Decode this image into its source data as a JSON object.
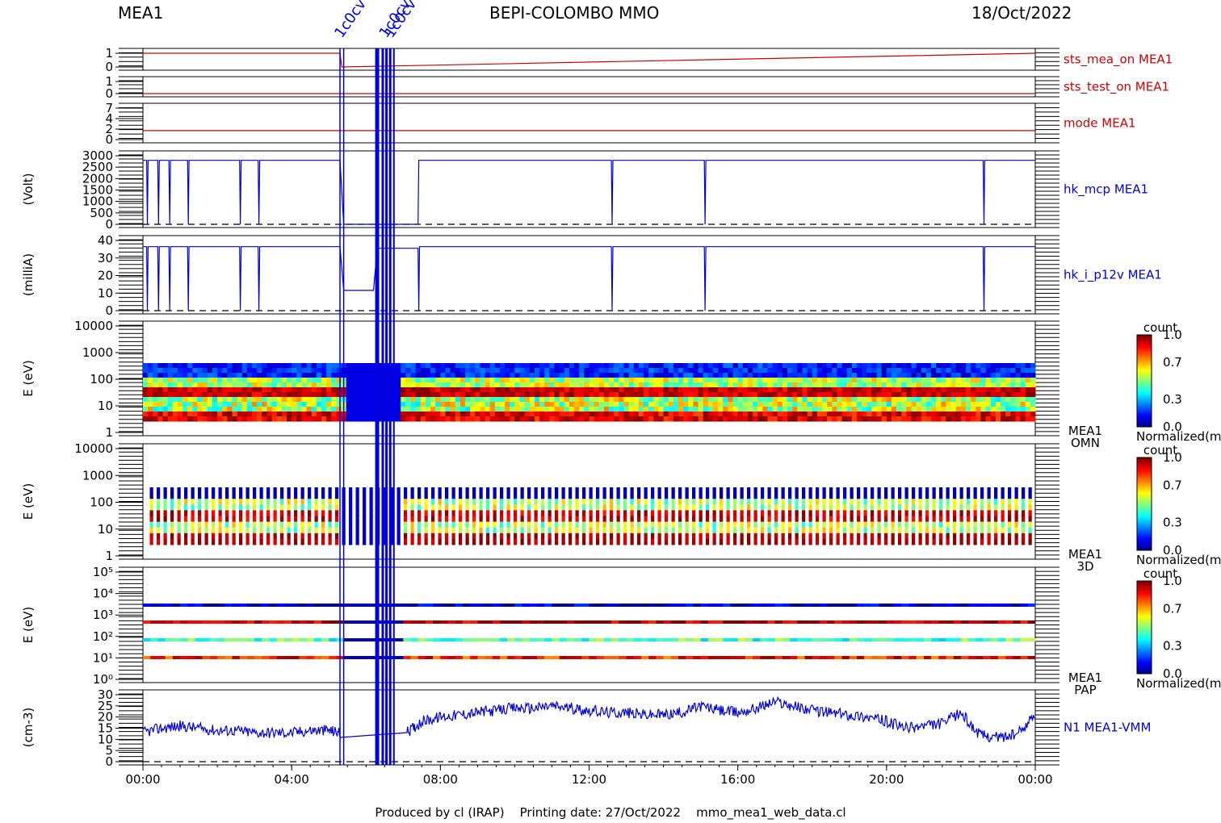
{
  "header": {
    "left": "MEA1",
    "center": "BEPI-COLOMBO MMO",
    "right": "18/Oct/2022"
  },
  "footer": "Produced by cl (IRAP)    Printing date: 27/Oct/2022    mmo_mea1_web_data.cl",
  "colors": {
    "status": "#d00000",
    "data": "#0000dd",
    "axis": "#000000"
  },
  "event_labels": [
    "1c0cv",
    "1c0cv",
    "1c0cv"
  ],
  "chart_data": [
    {
      "type": "line",
      "name": "sts_mea_on MEA1",
      "yticks": [
        "1",
        "0"
      ],
      "ylim": [
        0,
        1
      ],
      "x": [
        0,
        5.3,
        5.35,
        24
      ],
      "values": [
        1,
        1,
        0,
        1
      ]
    },
    {
      "type": "line",
      "name": "sts_test_on MEA1",
      "yticks": [
        "1",
        "0"
      ],
      "ylim": [
        0,
        1
      ],
      "x": [
        0,
        24
      ],
      "values": [
        0,
        0
      ]
    },
    {
      "type": "line",
      "name": "mode MEA1",
      "yticks": [
        "7",
        "4",
        "2",
        "0"
      ],
      "ylim": [
        0,
        7
      ],
      "x": [
        0,
        24
      ],
      "values": [
        2,
        2
      ]
    },
    {
      "type": "line",
      "name": "hk_mcp MEA1",
      "ylabel": "(Volt)",
      "yticks": [
        "3000",
        "2500",
        "2000",
        "1500",
        "1000",
        "500",
        "0"
      ],
      "ylim": [
        0,
        3000
      ],
      "x": [
        0,
        0.1,
        0.12,
        0.14,
        0.4,
        0.42,
        0.44,
        0.7,
        0.72,
        0.74,
        1.2,
        1.22,
        1.24,
        2.6,
        2.62,
        2.64,
        3.1,
        3.12,
        3.14,
        5.3,
        5.4,
        7.4,
        7.42,
        7.44,
        12.6,
        12.62,
        12.64,
        15.1,
        15.12,
        15.14,
        22.6,
        22.62,
        22.64,
        24
      ],
      "values": [
        2800,
        2800,
        0,
        2800,
        2800,
        0,
        2800,
        2800,
        0,
        2800,
        2800,
        0,
        2800,
        2800,
        0,
        2800,
        2800,
        0,
        2800,
        2800,
        0,
        0,
        2800,
        2800,
        2800,
        0,
        2800,
        2800,
        0,
        2800,
        2800,
        0,
        2800,
        2800
      ]
    },
    {
      "type": "line",
      "name": "hk_i_p12v MEA1",
      "ylabel": "(milliA)",
      "yticks": [
        "40",
        "30",
        "20",
        "10",
        "0"
      ],
      "ylim": [
        0,
        45
      ],
      "x": [
        0,
        0.1,
        0.12,
        0.14,
        0.4,
        0.42,
        0.44,
        0.7,
        0.72,
        0.74,
        1.2,
        1.22,
        1.24,
        2.6,
        2.62,
        2.64,
        3.1,
        3.12,
        3.14,
        5.3,
        5.4,
        6.2,
        6.3,
        7.4,
        7.42,
        7.44,
        12.6,
        12.62,
        12.64,
        15.1,
        15.12,
        15.14,
        22.6,
        22.62,
        22.64,
        24
      ],
      "values": [
        41,
        41,
        0,
        41,
        41,
        0,
        41,
        41,
        0,
        41,
        41,
        0,
        41,
        41,
        0,
        41,
        41,
        0,
        41,
        41,
        13,
        13,
        40,
        40,
        0,
        41,
        41,
        0,
        41,
        41,
        0,
        41,
        41,
        0,
        41,
        41
      ]
    },
    {
      "type": "heatmap",
      "name": "MEA1 OMN",
      "ylabel": "E (eV)",
      "yticks": [
        "10000",
        "1000",
        "100",
        "10",
        "1"
      ],
      "colorbar": {
        "label": "count",
        "ticks": [
          "1.0",
          "0.7",
          "0.3",
          "0.0"
        ],
        "unit": "Normalized(m"
      }
    },
    {
      "type": "heatmap",
      "name": "MEA1 3D",
      "ylabel": "E (eV)",
      "yticks": [
        "10000",
        "1000",
        "100",
        "10",
        "1"
      ],
      "colorbar": {
        "label": "count",
        "ticks": [
          "1.0",
          "0.7",
          "0.3",
          "0.0"
        ],
        "unit": "Normalized(m"
      }
    },
    {
      "type": "heatmap",
      "name": "MEA1 PAP",
      "ylabel": "E (eV)",
      "yticks": [
        "10⁵",
        "10⁴",
        "10³",
        "10²",
        "10¹",
        "10⁰"
      ],
      "colorbar": {
        "label": "count",
        "ticks": [
          "1.0",
          "0.7",
          "0.3",
          "0.0"
        ],
        "unit": "Normalized(m"
      }
    },
    {
      "type": "line",
      "name": "N1 MEA1-VMM",
      "ylabel": "(cm-3)",
      "yticks": [
        "30",
        "25",
        "20",
        "15",
        "10",
        "5",
        "0"
      ],
      "ylim": [
        0,
        30
      ],
      "x": [
        0,
        0.5,
        1,
        1.5,
        2,
        2.5,
        3,
        3.5,
        4,
        4.5,
        5,
        5.3,
        7.1,
        7.5,
        8,
        8.5,
        9,
        9.5,
        10,
        10.5,
        11,
        11.5,
        12,
        12.5,
        13,
        13.5,
        14,
        14.5,
        15,
        15.5,
        16,
        16.5,
        17,
        17.5,
        18,
        18.5,
        19,
        19.5,
        20,
        20.5,
        21,
        21.5,
        22,
        22.5,
        23,
        23.5,
        24
      ],
      "values": [
        13,
        15,
        16,
        15,
        14,
        14,
        13,
        13,
        13,
        14,
        14,
        13,
        13,
        18,
        20,
        21,
        22,
        23,
        24,
        24,
        25,
        24,
        23,
        22,
        22,
        21,
        21,
        22,
        25,
        23,
        22,
        24,
        27,
        25,
        23,
        22,
        21,
        20,
        18,
        15,
        16,
        17,
        22,
        12,
        11,
        12,
        21
      ]
    }
  ],
  "x_axis": {
    "ticks": [
      "00:00",
      "04:00",
      "08:00",
      "12:00",
      "16:00",
      "20:00",
      "00:00"
    ],
    "range": [
      0,
      24
    ]
  }
}
